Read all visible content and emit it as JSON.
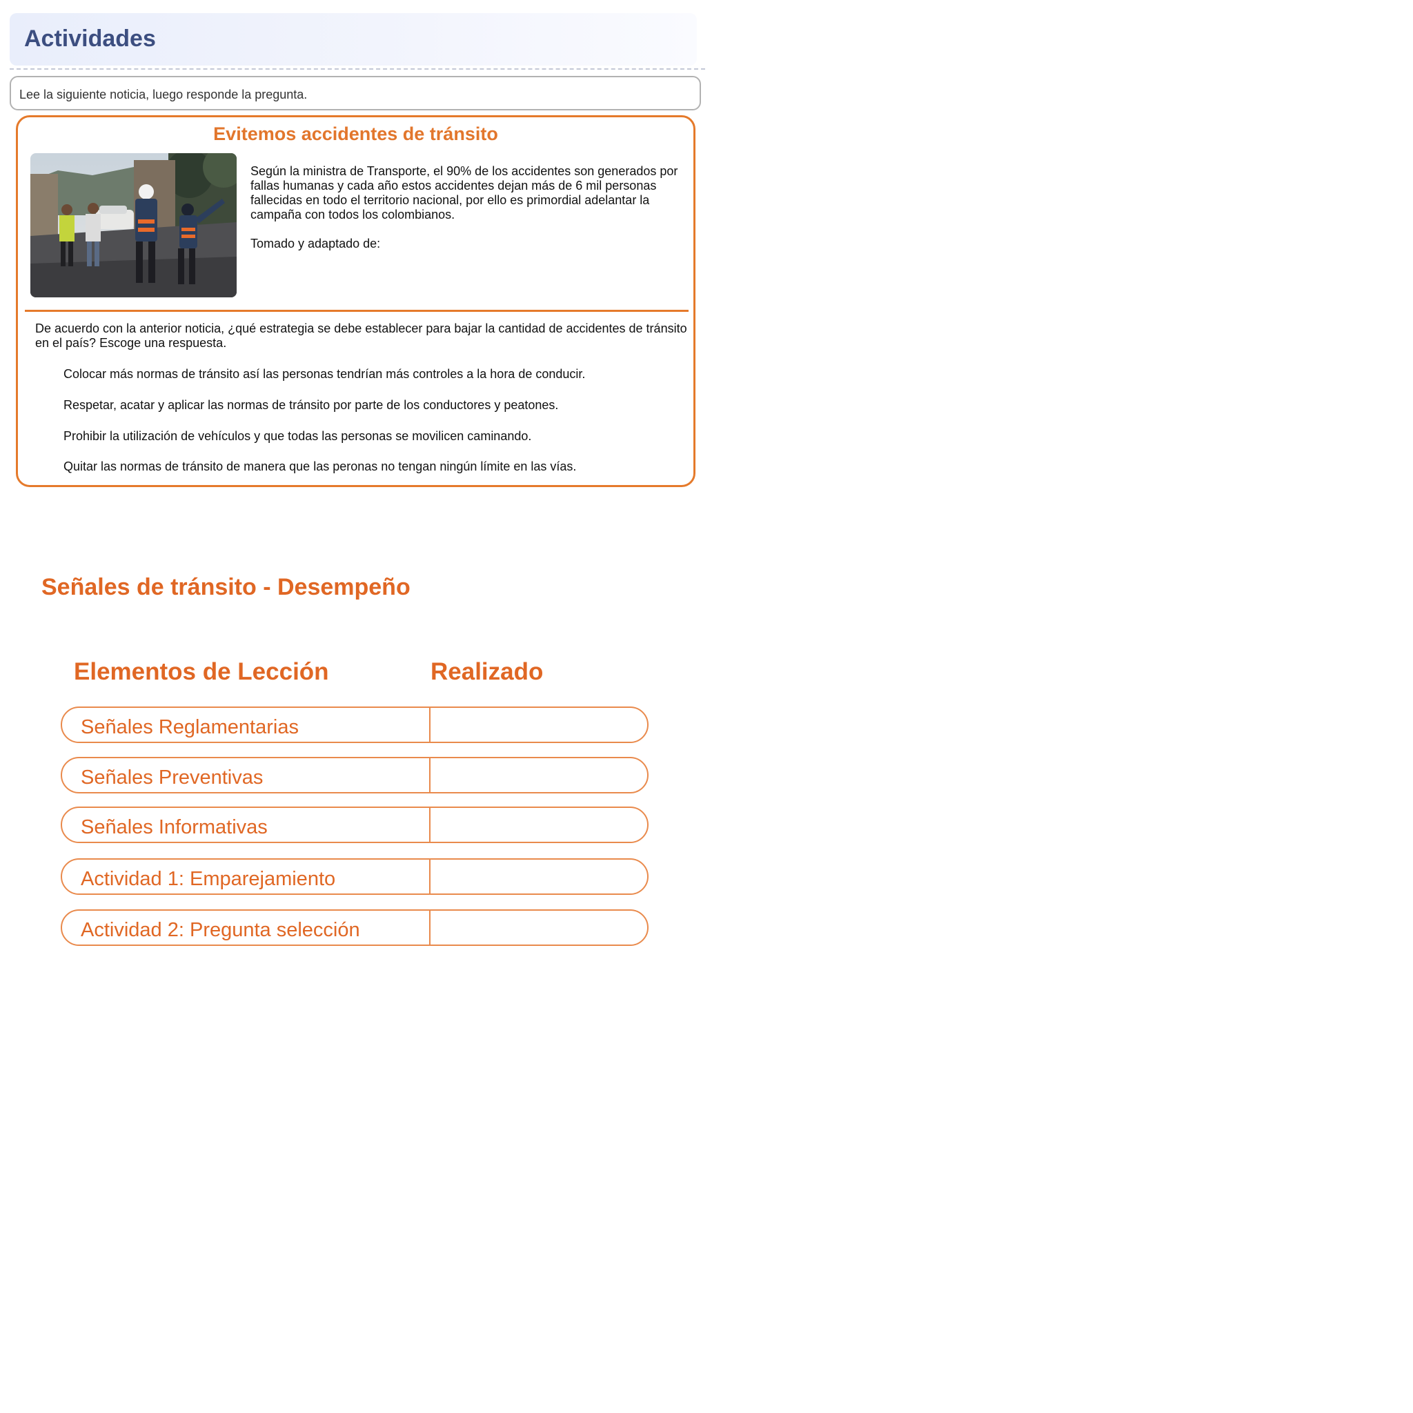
{
  "header": {
    "title": "Actividades"
  },
  "instruction": "Lee la siguiente noticia, luego responde la pregunta.",
  "news": {
    "title": "Evitemos accidentes de tránsito",
    "body": "Según la ministra de Transporte, el 90% de los accidentes son generados por fallas humanas y cada año estos accidentes dejan más de 6 mil personas fallecidas en todo el territorio nacional, por ello es primordial adelantar la campaña con todos los colombianos.",
    "source_label": "Tomado y adaptado de:"
  },
  "question": {
    "text": "De acuerdo con la anterior noticia, ¿qué estrategia se debe establecer para bajar la cantidad de accidentes de tránsito en el país? Escoge una respuesta.",
    "options": [
      "Colocar más normas de tránsito así las personas tendrían más controles a la hora de conducir.",
      "Respetar, acatar y aplicar las normas de tránsito por parte de los conductores y peatones.",
      "Prohibir la utilización de vehículos y que todas las personas se movilicen caminando.",
      "Quitar las normas de tránsito de manera que las peronas no tengan ningún límite en las vías."
    ]
  },
  "performance": {
    "title": "Señales de tránsito - Desempeño",
    "col_items": "Elementos de Lección",
    "col_done": "Realizado",
    "rows": [
      {
        "label": "Señales Reglamentarias",
        "done": ""
      },
      {
        "label": "Señales Preventivas",
        "done": ""
      },
      {
        "label": "Señales Informativas",
        "done": ""
      },
      {
        "label": "Actividad 1: Emparejamiento",
        "done": ""
      },
      {
        "label": "Actividad 2: Pregunta selección",
        "done": ""
      }
    ]
  }
}
